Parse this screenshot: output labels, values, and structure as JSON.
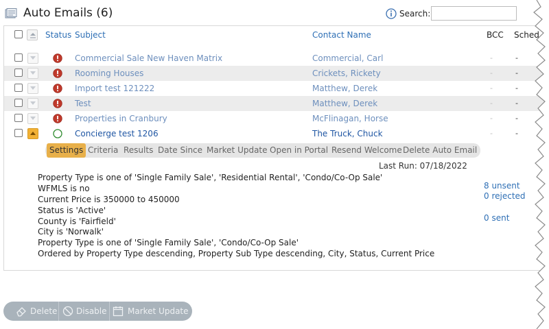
{
  "header": {
    "title": "Auto Emails (6)",
    "search_label": "Search:",
    "search_value": ""
  },
  "table": {
    "columns": {
      "status": "Status",
      "subject": "Subject",
      "contact": "Contact Name",
      "bcc": "BCC",
      "sched": "Sched"
    },
    "rows": [
      {
        "status": "error",
        "subject": "Commercial Sale New Haven Matrix",
        "contact": "Commercial, Carl",
        "bcc": "-",
        "sched": "-"
      },
      {
        "status": "error",
        "subject": "Rooming Houses",
        "contact": "Crickets, Rickety",
        "bcc": "-",
        "sched": "-"
      },
      {
        "status": "error",
        "subject": "Import test 121222",
        "contact": "Matthew, Derek",
        "bcc": "-",
        "sched": "-"
      },
      {
        "status": "error",
        "subject": "Test",
        "contact": "Matthew, Derek",
        "bcc": "-",
        "sched": "-"
      },
      {
        "status": "error",
        "subject": "Properties in Cranbury",
        "contact": "McFlinagan, Horse",
        "bcc": "-",
        "sched": "-"
      },
      {
        "status": "active",
        "subject": "Concierge test 1206",
        "contact": "The Truck, Chuck",
        "bcc": "-",
        "sched": "-"
      }
    ]
  },
  "detail": {
    "tabs": [
      "Settings",
      "Criteria",
      "Results",
      "Date Since",
      "Market Update",
      "Open in Portal",
      "Resend Welcome",
      "Delete Auto Email"
    ],
    "active_tab": "Settings",
    "last_run": "Last Run: 07/18/2022",
    "criteria": [
      "Property Type is one of 'Single Family Sale', 'Residential Rental', 'Condo/Co-Op Sale'",
      "WFMLS is no",
      "Current Price is 350000 to 450000",
      "Status is 'Active'",
      "County is 'Fairfield'",
      "City is 'Norwalk'",
      "Property Type is one of 'Single Family Sale', 'Condo/Co-Op Sale'",
      "Ordered by Property Type descending, Property Sub Type descending, City, Status, Current Price"
    ],
    "stats": {
      "unsent": "8 unsent",
      "rejected": "0 rejected",
      "sent": "0 sent"
    }
  },
  "actions": {
    "delete": "Delete",
    "disable": "Disable",
    "market_update": "Market Update"
  },
  "colors": {
    "link": "#2e6fb5",
    "link_muted": "#6d8fbd",
    "error_red": "#c0392b",
    "active_green": "#2e8b2e",
    "tab_active": "#e8b04a",
    "button_bar": "#a9b3bb"
  },
  "icons": {
    "title": "email-list-icon",
    "info": "info-icon",
    "error": "error-icon",
    "active": "circle-outline-icon",
    "delete": "eraser-icon",
    "disable": "ban-icon",
    "market_update": "calendar-icon"
  }
}
